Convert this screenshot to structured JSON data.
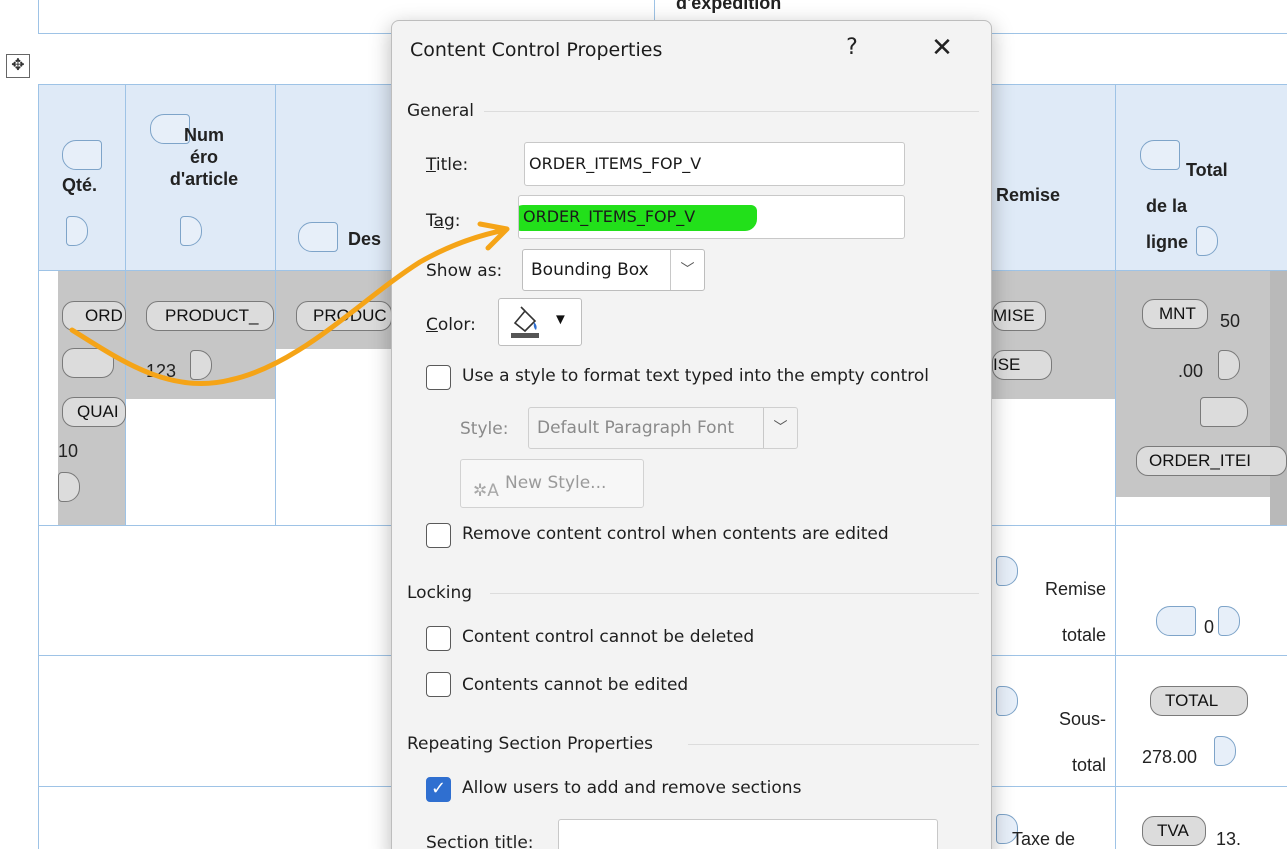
{
  "document": {
    "top_text": "d'expédition",
    "headers": {
      "qty": "Qté.",
      "item_number": "Num\néro\nd'article",
      "description": "Des",
      "discount": "Remise",
      "line_total": "Total\nde la\nligne"
    },
    "row_tags": {
      "ord": "ORD",
      "product_num": "PRODUCT_",
      "product_desc": "PRODUC",
      "num_123": "123",
      "quan": "QUAI",
      "qty_10": "10",
      "remise_a": "MISE",
      "remise_b": "ISE",
      "mnt": "MNT",
      "mnt_val1": "50",
      "mnt_val2": ".00",
      "order_items": "ORDER_ITEI"
    },
    "summary": {
      "remise_totale": "Remise\ntotale",
      "remise_value": "0",
      "sous_total": "Sous-\ntotal",
      "total_tag": "TOTAL",
      "total_value": "278.00",
      "taxe": "Taxe de",
      "tva_tag": "TVA",
      "tva_value": "13."
    }
  },
  "dialog": {
    "title": "Content Control Properties",
    "help": "?",
    "close": "✕",
    "general": {
      "heading": "General",
      "title_label": "Title:",
      "title_value": "ORDER_ITEMS_FOP_V",
      "tag_label": "Tag:",
      "tag_value": "ORDER_ITEMS_FOP_V",
      "show_as_label": "Show as:",
      "show_as_value": "Bounding Box",
      "color_label": "Color:",
      "use_style_label": "Use a style to format text typed into the empty control",
      "style_label": "Style:",
      "style_value": "Default Paragraph Font",
      "new_style_label": "New Style...",
      "remove_cc_label": "Remove content control when contents are edited"
    },
    "locking": {
      "heading": "Locking",
      "cannot_delete_label": "Content control cannot be deleted",
      "cannot_edit_label": "Contents cannot be edited"
    },
    "repeating": {
      "heading": "Repeating Section Properties",
      "allow_add_remove_label": "Allow users to add and remove sections",
      "section_title_label": "Section title:"
    }
  },
  "colors": {
    "highlight": "#22e01a",
    "arrow": "#f5a417",
    "table_border": "#9ec3e6",
    "header_fill": "#dfeaf7",
    "checkbox_accent": "#2f6fd0"
  }
}
